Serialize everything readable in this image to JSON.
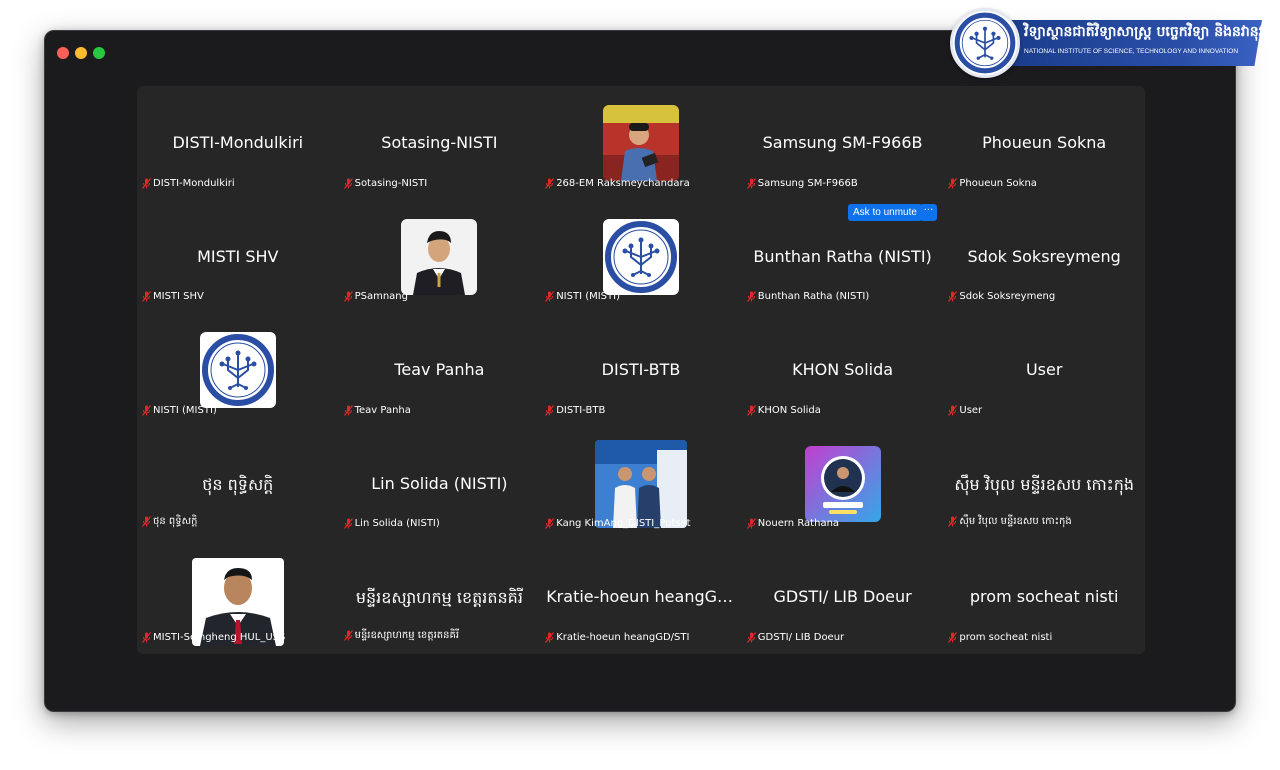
{
  "banner": {
    "kh_title": "វិទ្យាស្ថានជាតិវិទ្យាសាស្ត្រ បច្ចេកវិទ្យា និងនវានុវត្តន៍",
    "en_title": "NATIONAL INSTITUTE OF SCIENCE, TECHNOLOGY AND INNOVATION"
  },
  "unmute": {
    "label": "Ask to unmute",
    "more": "···"
  },
  "participants": [
    {
      "name": "DISTI-Mondulkiri",
      "center": "DISTI-Mondulkiri"
    },
    {
      "name": "Sotasing-NISTI",
      "center": "Sotasing-NISTI"
    },
    {
      "name": "268-EM Raksmeychandara",
      "center": ""
    },
    {
      "name": "Samsung SM-F966B",
      "center": "Samsung SM-F966B"
    },
    {
      "name": "Phoueun Sokna",
      "center": "Phoueun Sokna"
    },
    {
      "name": "MISTI SHV",
      "center": "MISTI SHV"
    },
    {
      "name": "PSamnang",
      "center": ""
    },
    {
      "name": "NISTI (MISTI)",
      "center": ""
    },
    {
      "name": "Bunthan Ratha (NISTI)",
      "center": "Bunthan Ratha (NISTI)"
    },
    {
      "name": "Sdok Soksreymeng",
      "center": "Sdok Soksreymeng"
    },
    {
      "name": "NISTI (MISTI)",
      "center": ""
    },
    {
      "name": "Teav Panha",
      "center": "Teav Panha"
    },
    {
      "name": "DISTI-BTB",
      "center": "DISTI-BTB"
    },
    {
      "name": "KHON Solida",
      "center": "KHON Solida"
    },
    {
      "name": "User",
      "center": "User"
    },
    {
      "name": "ថុន ពុទ្ធិសក្តិ",
      "center": "ថុន ពុទ្ធិសក្តិ"
    },
    {
      "name": "Lin Solida (NISTI)",
      "center": "Lin Solida (NISTI)"
    },
    {
      "name": "Kang KimAng_DISTI_Putsat",
      "center": ""
    },
    {
      "name": "Nouern Rathana",
      "center": ""
    },
    {
      "name": "ស៊ឹម វិបុល មន្ទីរឧសប​ កោះកុង",
      "center": "ស៊ឹម វិបុល មន្ទីរឧសប​ កោះកុង"
    },
    {
      "name": "MISTI-Seingheng HUL_USS",
      "center": ""
    },
    {
      "name": "មន្ទីរឧស្សាហកម្ម ខេត្តរតនគិរី",
      "center": "មន្ទីរឧស្សាហកម្ម ខេត្តរតនគិរី"
    },
    {
      "name": "Kratie-hoeun heangGD/STI",
      "center": "Kratie-hoeun heangGD/..."
    },
    {
      "name": "GDSTI/ LIB Doeur",
      "center": "GDSTI/ LIB Doeur"
    },
    {
      "name": "prom socheat nisti",
      "center": "prom socheat nisti"
    }
  ]
}
